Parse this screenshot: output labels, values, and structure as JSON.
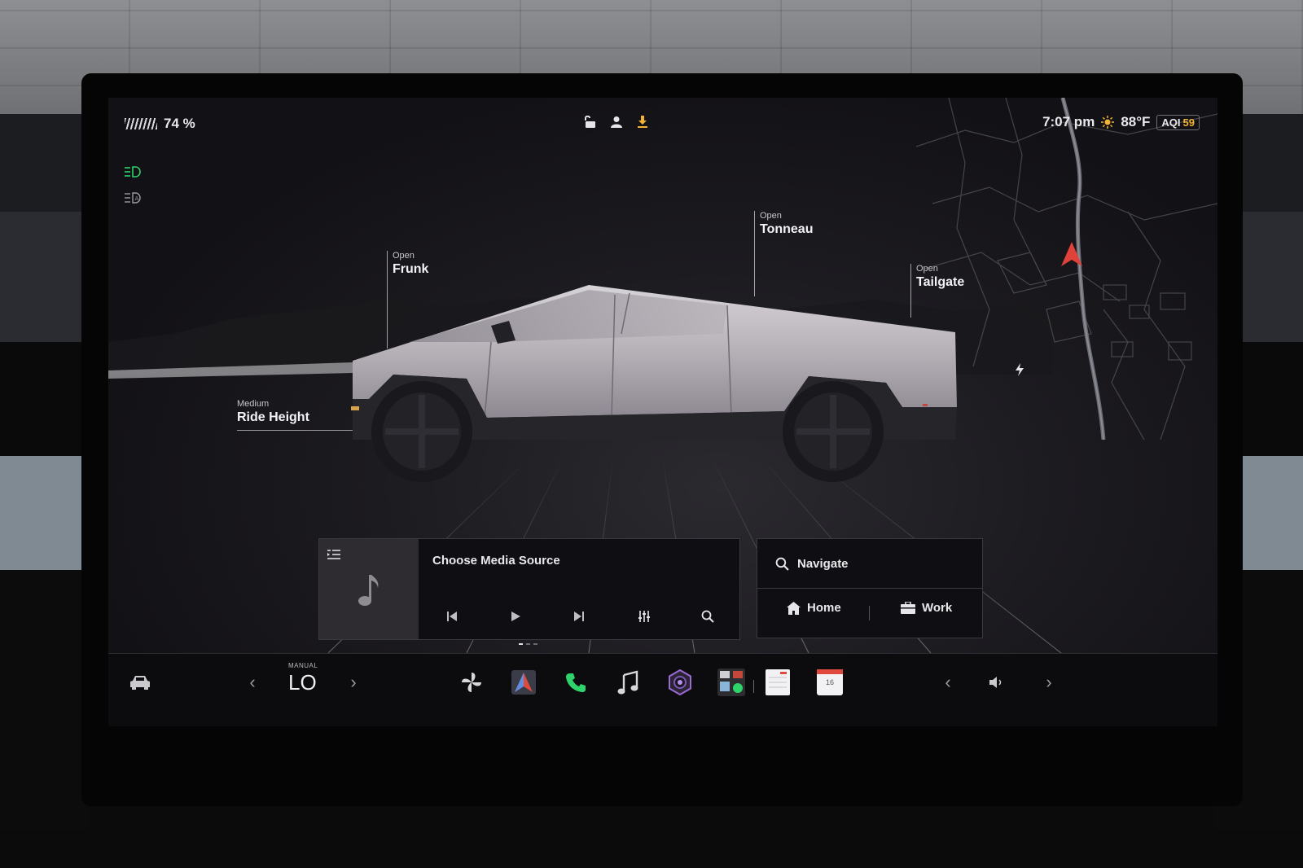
{
  "status": {
    "battery_percent": "74 %",
    "time": "7:07 pm",
    "temperature": "88°F",
    "aqi_label": "AQI",
    "aqi_value": "59",
    "icons": [
      "unlock-icon",
      "driver-profile-icon",
      "software-update-icon"
    ]
  },
  "indicators": [
    "headlights-on-icon",
    "auto-high-beam-icon"
  ],
  "vehicle": {
    "callouts": {
      "frunk": {
        "action": "Open",
        "label": "Frunk"
      },
      "tonneau": {
        "action": "Open",
        "label": "Tonneau"
      },
      "tailgate": {
        "action": "Open",
        "label": "Tailgate"
      },
      "ride_height": {
        "level": "Medium",
        "label": "Ride Height"
      }
    }
  },
  "media": {
    "title": "Choose Media Source",
    "controls": [
      "previous-track",
      "play",
      "next-track",
      "equalizer",
      "search"
    ]
  },
  "navigation": {
    "search_label": "Navigate",
    "home_label": "Home",
    "work_label": "Work"
  },
  "dock": {
    "climate_mode": "MANUAL",
    "climate_value": "LO",
    "calendar_day": "16",
    "apps": [
      "car-icon",
      "fan-icon",
      "navigation-app-icon",
      "phone-icon",
      "music-icon",
      "camera-icon",
      "app-launcher-icon",
      "notes-icon",
      "calendar-icon"
    ],
    "volume_icon": "volume-icon"
  },
  "colors": {
    "accent_green": "#2fd36b",
    "update_orange": "#f2b233",
    "nav_arrow_red": "#e0413a"
  }
}
